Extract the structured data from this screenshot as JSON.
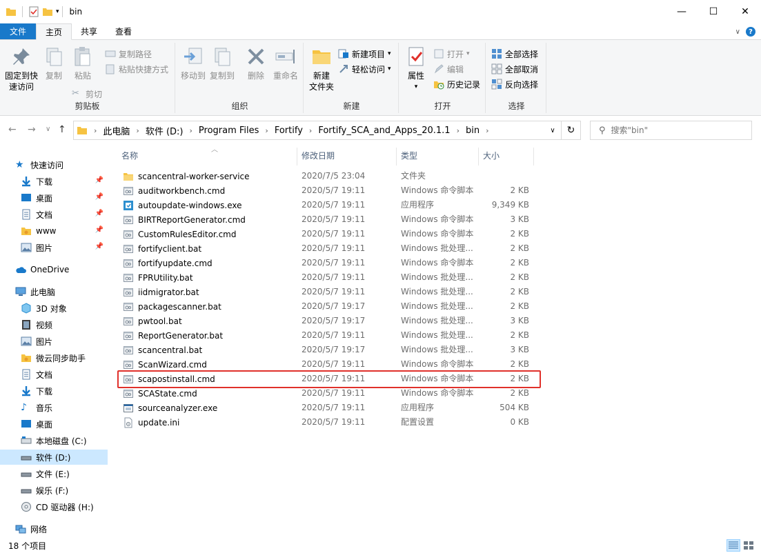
{
  "window": {
    "title": "bin",
    "controls": {
      "minimize": "—",
      "maximize": "☐",
      "close": "✕"
    }
  },
  "ribbon_tabs": [
    "文件",
    "主页",
    "共享",
    "查看"
  ],
  "ribbon_right": {
    "help": "?"
  },
  "ribbon": {
    "clipboard": {
      "label": "剪贴板",
      "pin": "固定到快\n速访问",
      "copy": "复制",
      "paste": "粘贴",
      "copy_path": "复制路径",
      "paste_shortcut": "粘贴快捷方式",
      "cut": "剪切"
    },
    "organize": {
      "label": "组织",
      "move_to": "移动到",
      "copy_to": "复制到",
      "delete": "删除",
      "rename": "重命名"
    },
    "new": {
      "label": "新建",
      "new_folder": "新建\n文件夹",
      "new_item": "新建项目",
      "easy_access": "轻松访问"
    },
    "open": {
      "label": "打开",
      "properties": "属性",
      "open": "打开",
      "edit": "编辑",
      "history": "历史记录"
    },
    "select": {
      "label": "选择",
      "select_all": "全部选择",
      "select_none": "全部取消",
      "invert": "反向选择"
    }
  },
  "breadcrumb": [
    "此电脑",
    "软件 (D:)",
    "Program Files",
    "Fortify",
    "Fortify_SCA_and_Apps_20.1.1",
    "bin"
  ],
  "search": {
    "placeholder": "搜索\"bin\""
  },
  "nav": {
    "quick_access": "快速访问",
    "quick_items": [
      "下载",
      "桌面",
      "文档",
      "www",
      "图片"
    ],
    "onedrive": "OneDrive",
    "this_pc": "此电脑",
    "pc_items": [
      "3D 对象",
      "视频",
      "图片",
      "微云同步助手",
      "文档",
      "下载",
      "音乐",
      "桌面",
      "本地磁盘 (C:)",
      "软件 (D:)",
      "文件 (E:)",
      "娱乐 (F:)",
      "CD 驱动器 (H:)"
    ],
    "network": "网络"
  },
  "columns": {
    "name": "名称",
    "date": "修改日期",
    "type": "类型",
    "size": "大小"
  },
  "files": [
    {
      "name": "scancentral-worker-service",
      "date": "2020/7/5 23:04",
      "type": "文件夹",
      "size": "",
      "icon": "folder"
    },
    {
      "name": "auditworkbench.cmd",
      "date": "2020/5/7 19:11",
      "type": "Windows 命令脚本",
      "size": "2 KB",
      "icon": "script"
    },
    {
      "name": "autoupdate-windows.exe",
      "date": "2020/5/7 19:11",
      "type": "应用程序",
      "size": "9,349 KB",
      "icon": "exe-blue"
    },
    {
      "name": "BIRTReportGenerator.cmd",
      "date": "2020/5/7 19:11",
      "type": "Windows 命令脚本",
      "size": "3 KB",
      "icon": "script"
    },
    {
      "name": "CustomRulesEditor.cmd",
      "date": "2020/5/7 19:11",
      "type": "Windows 命令脚本",
      "size": "2 KB",
      "icon": "script"
    },
    {
      "name": "fortifyclient.bat",
      "date": "2020/5/7 19:11",
      "type": "Windows 批处理...",
      "size": "2 KB",
      "icon": "script"
    },
    {
      "name": "fortifyupdate.cmd",
      "date": "2020/5/7 19:11",
      "type": "Windows 命令脚本",
      "size": "2 KB",
      "icon": "script"
    },
    {
      "name": "FPRUtility.bat",
      "date": "2020/5/7 19:11",
      "type": "Windows 批处理...",
      "size": "2 KB",
      "icon": "script"
    },
    {
      "name": "iidmigrator.bat",
      "date": "2020/5/7 19:11",
      "type": "Windows 批处理...",
      "size": "2 KB",
      "icon": "script"
    },
    {
      "name": "packagescanner.bat",
      "date": "2020/5/7 19:17",
      "type": "Windows 批处理...",
      "size": "2 KB",
      "icon": "script"
    },
    {
      "name": "pwtool.bat",
      "date": "2020/5/7 19:17",
      "type": "Windows 批处理...",
      "size": "3 KB",
      "icon": "script"
    },
    {
      "name": "ReportGenerator.bat",
      "date": "2020/5/7 19:11",
      "type": "Windows 批处理...",
      "size": "2 KB",
      "icon": "script"
    },
    {
      "name": "scancentral.bat",
      "date": "2020/5/7 19:17",
      "type": "Windows 批处理...",
      "size": "3 KB",
      "icon": "script"
    },
    {
      "name": "ScanWizard.cmd",
      "date": "2020/5/7 19:11",
      "type": "Windows 命令脚本",
      "size": "2 KB",
      "icon": "script"
    },
    {
      "name": "scapostinstall.cmd",
      "date": "2020/5/7 19:11",
      "type": "Windows 命令脚本",
      "size": "2 KB",
      "icon": "script"
    },
    {
      "name": "SCAState.cmd",
      "date": "2020/5/7 19:11",
      "type": "Windows 命令脚本",
      "size": "2 KB",
      "icon": "script"
    },
    {
      "name": "sourceanalyzer.exe",
      "date": "2020/5/7 19:11",
      "type": "应用程序",
      "size": "504 KB",
      "icon": "exe"
    },
    {
      "name": "update.ini",
      "date": "2020/5/7 19:11",
      "type": "配置设置",
      "size": "0 KB",
      "icon": "ini"
    }
  ],
  "status": {
    "count": "18 个项目"
  },
  "colors": {
    "accent": "#1979ca",
    "folder": "#f6c342",
    "selected": "#cce8ff",
    "highlight": "#e0302a"
  }
}
